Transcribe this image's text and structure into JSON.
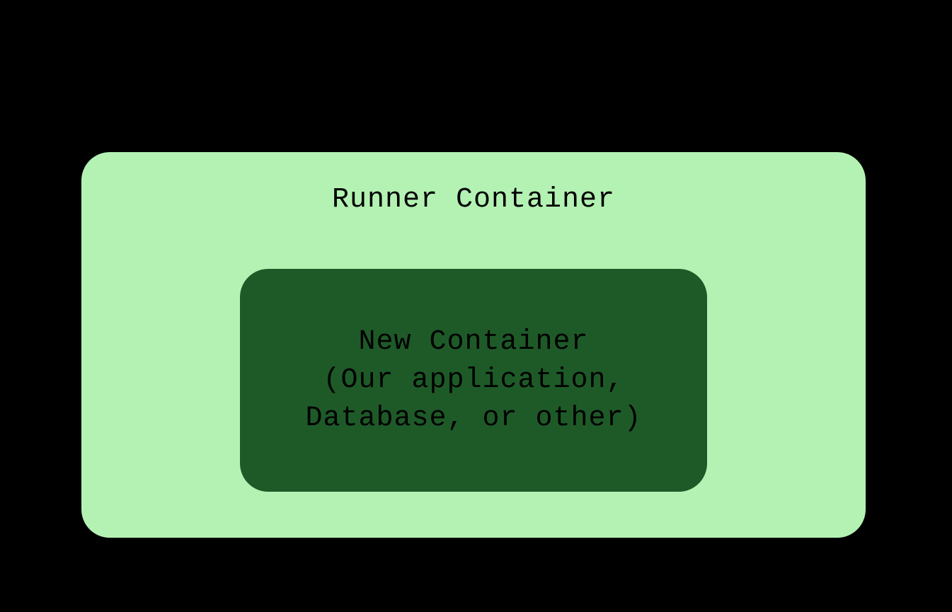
{
  "diagram": {
    "outer": {
      "label": "Runner Container",
      "color": "#b4f2b4"
    },
    "inner": {
      "line1": "New Container",
      "line2": "(Our application,",
      "line3": "Database, or other)",
      "color": "#1e5a28"
    }
  }
}
